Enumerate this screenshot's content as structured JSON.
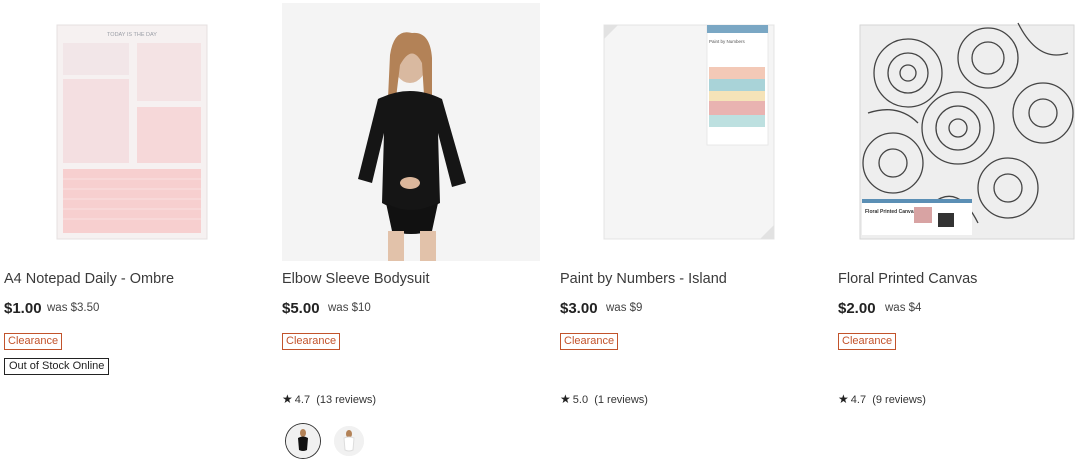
{
  "products": [
    {
      "title": "A4 Notepad Daily - Ombre",
      "price": "$1.00",
      "was": "was $3.50",
      "badge": "Clearance",
      "stock": "Out of Stock Online",
      "image": {
        "header": "TODAY IS THE DAY"
      }
    },
    {
      "title": "Elbow Sleeve Bodysuit",
      "price": "$5.00",
      "was": "was $10",
      "badge": "Clearance",
      "rating": "4.7",
      "reviews": "(13 reviews)"
    },
    {
      "title": "Paint by Numbers - Island",
      "price": "$3.00",
      "was": "was $9",
      "badge": "Clearance",
      "rating": "5.0",
      "reviews": "(1 reviews)",
      "image": {
        "label": "Paint by Numbers"
      }
    },
    {
      "title": "Floral Printed Canvas",
      "price": "$2.00",
      "was": "was $4",
      "badge": "Clearance",
      "rating": "4.7",
      "reviews": "(9 reviews)",
      "image": {
        "label": "Floral Printed Canvas"
      }
    }
  ],
  "colors": {
    "clearance": "#c2532b",
    "text": "#222222"
  }
}
